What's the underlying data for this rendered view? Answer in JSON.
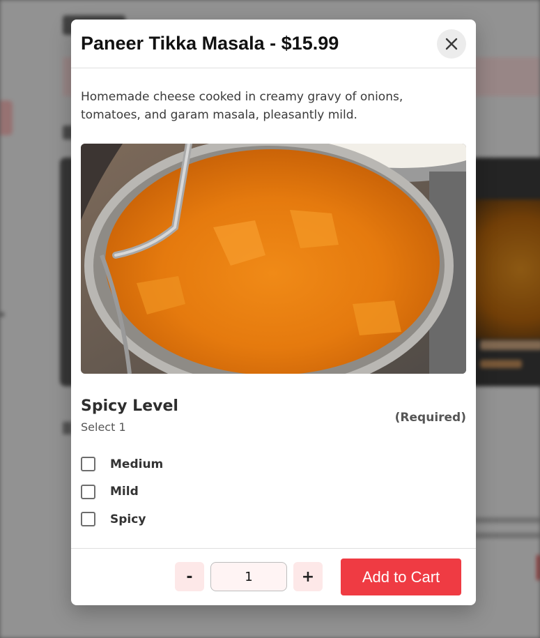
{
  "modal": {
    "title": "Paneer Tikka Masala - $15.99",
    "description": "Homemade cheese cooked in creamy gravy of onions, tomatoes, and garam masala, pleasantly mild.",
    "close_icon": "close-icon",
    "image_alt": "Paneer tikka masala in a metal bowl"
  },
  "spicy_level": {
    "title": "Spicy Level",
    "subtitle": "Select 1",
    "required_label": "(Required)",
    "options": [
      {
        "label": "Medium",
        "checked": false
      },
      {
        "label": "Mild",
        "checked": false
      },
      {
        "label": "Spicy",
        "checked": false
      }
    ]
  },
  "footer": {
    "minus_label": "-",
    "quantity": "1",
    "plus_label": "+",
    "add_to_cart_label": "Add to Cart"
  },
  "colors": {
    "accent": "#ef3b43",
    "qty_button_bg": "#fde8e8",
    "overlay": "#8f8f8f"
  }
}
